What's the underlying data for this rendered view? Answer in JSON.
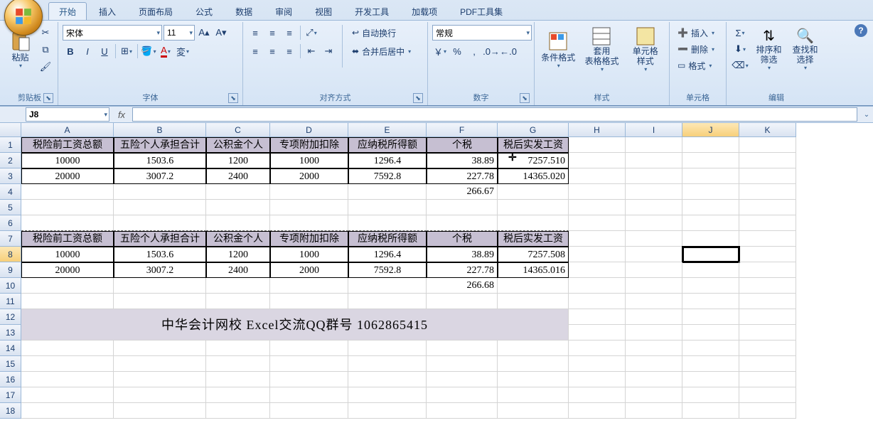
{
  "tabs": [
    "开始",
    "插入",
    "页面布局",
    "公式",
    "数据",
    "审阅",
    "视图",
    "开发工具",
    "加载项",
    "PDF工具集"
  ],
  "active_tab": 0,
  "ribbon": {
    "clipboard": {
      "paste": "粘贴",
      "label": "剪贴板"
    },
    "font": {
      "name": "宋体",
      "size": "11",
      "label": "字体",
      "bold": "B",
      "italic": "I",
      "underline": "U"
    },
    "alignment": {
      "wrap": "自动换行",
      "merge": "合并后居中",
      "label": "对齐方式"
    },
    "number": {
      "format": "常规",
      "label": "数字"
    },
    "styles": {
      "cond": "条件格式",
      "table": "套用\n表格格式",
      "cell": "单元格\n样式",
      "label": "样式"
    },
    "cells": {
      "insert": "插入",
      "delete": "删除",
      "format": "格式",
      "label": "单元格"
    },
    "editing": {
      "sort": "排序和\n筛选",
      "find": "查找和\n选择",
      "label": "编辑"
    }
  },
  "namebox": "J8",
  "columns": [
    "A",
    "B",
    "C",
    "D",
    "E",
    "F",
    "G",
    "H",
    "I",
    "J",
    "K"
  ],
  "rows": 18,
  "selected_row": 8,
  "selected_col": "J",
  "table1": {
    "headers": [
      "税险前工资总额",
      "五险个人承担合计",
      "公积金个人",
      "专项附加扣除",
      "应纳税所得额",
      "个税",
      "税后实发工资"
    ],
    "rows": [
      [
        "10000",
        "1503.6",
        "1200",
        "1000",
        "1296.4",
        "38.89",
        "7257.510"
      ],
      [
        "20000",
        "3007.2",
        "2400",
        "2000",
        "7592.8",
        "227.78",
        "14365.020"
      ]
    ],
    "extra_F": "266.67"
  },
  "table2": {
    "headers": [
      "税险前工资总额",
      "五险个人承担合计",
      "公积金个人",
      "专项附加扣除",
      "应纳税所得额",
      "个税",
      "税后实发工资"
    ],
    "rows": [
      [
        "10000",
        "1503.6",
        "1200",
        "1000",
        "1296.4",
        "38.89",
        "7257.508"
      ],
      [
        "20000",
        "3007.2",
        "2400",
        "2000",
        "7592.8",
        "227.78",
        "14365.016"
      ]
    ],
    "extra_F": "266.68"
  },
  "banner": "中华会计网校 Excel交流QQ群号 1062865415",
  "cursor_overlay": "⊕"
}
